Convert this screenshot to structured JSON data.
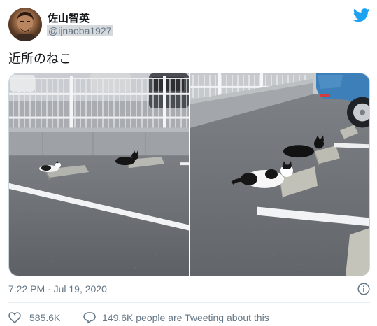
{
  "author": {
    "display_name": "佐山智英",
    "handle": "@ijnaoba1927",
    "avatar_icon": "profile-photo"
  },
  "tweet": {
    "text": "近所のねこ",
    "timestamp": "7:22 PM · Jul 19, 2020"
  },
  "media": {
    "photos": [
      "parking-lot-cats-wide",
      "parking-lot-cats-closeup"
    ]
  },
  "engagement": {
    "like_count": "585.6K",
    "reply_text": "149.6K people are Tweeting about this"
  },
  "icons": {
    "brand": "twitter-bird-icon",
    "info": "info-icon",
    "like": "heart-icon",
    "reply": "speech-bubble-icon"
  },
  "colors": {
    "brand_blue": "#1da1f2",
    "secondary_text": "#657786",
    "divider": "#e6ecf0"
  }
}
